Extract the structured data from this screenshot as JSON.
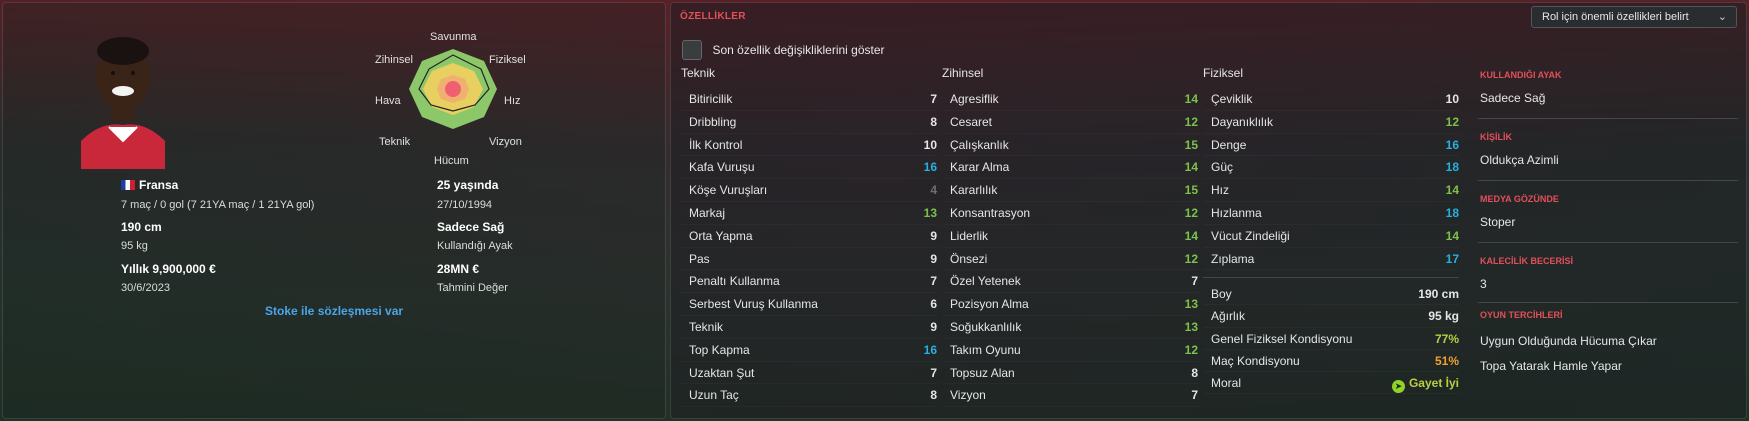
{
  "player": {
    "nationality": "Fransa",
    "caps": "7 maç / 0 gol (7 21YA maç / 1 21YA gol)",
    "age": "25 yaşında",
    "dob": "27/10/1994",
    "height": "190 cm",
    "weight": "95 kg",
    "foot": "Sadece Sağ",
    "foot_label": "Kullandığı Ayak",
    "wage": "Yıllık 9,900,000 €",
    "contract_end": "30/6/2023",
    "value": "28MN €",
    "value_label": "Tahmini Değer",
    "contract_text": "Stoke ile sözleşmesi var"
  },
  "radar": {
    "labels": {
      "top": "Savunma",
      "top_right": "Fiziksel",
      "right": "Hız",
      "bottom_right": "Vizyon",
      "bottom": "Hücum",
      "bottom_left": "Teknik",
      "left": "Hava",
      "top_left": "Zihinsel"
    },
    "colors": {
      "outer": "#8cc86a",
      "mid": "#e8d060",
      "inner": "#f0b070",
      "core": "#f06070"
    }
  },
  "attributes": {
    "section_title": "ÖZELLİKLER",
    "role_select": "Rol için önemli özellikleri belirt",
    "show_changes": "Son özellik değişikliklerini göster",
    "technical": {
      "title": "Teknik",
      "rows": [
        {
          "name": "Bitiricilik",
          "value": "7",
          "c": "white"
        },
        {
          "name": "Dribbling",
          "value": "8",
          "c": "white"
        },
        {
          "name": "İlk Kontrol",
          "value": "10",
          "c": "white"
        },
        {
          "name": "Kafa Vuruşu",
          "value": "16",
          "c": "blue"
        },
        {
          "name": "Köşe Vuruşları",
          "value": "4",
          "c": "gray"
        },
        {
          "name": "Markaj",
          "value": "13",
          "c": "green"
        },
        {
          "name": "Orta Yapma",
          "value": "9",
          "c": "white"
        },
        {
          "name": "Pas",
          "value": "9",
          "c": "white"
        },
        {
          "name": "Penaltı Kullanma",
          "value": "7",
          "c": "white"
        },
        {
          "name": "Serbest Vuruş Kullanma",
          "value": "6",
          "c": "white"
        },
        {
          "name": "Teknik",
          "value": "9",
          "c": "white"
        },
        {
          "name": "Top Kapma",
          "value": "16",
          "c": "blue"
        },
        {
          "name": "Uzaktan Şut",
          "value": "7",
          "c": "white"
        },
        {
          "name": "Uzun Taç",
          "value": "8",
          "c": "white"
        }
      ]
    },
    "mental": {
      "title": "Zihinsel",
      "rows": [
        {
          "name": "Agresiflik",
          "value": "14",
          "c": "green"
        },
        {
          "name": "Cesaret",
          "value": "12",
          "c": "green"
        },
        {
          "name": "Çalışkanlık",
          "value": "15",
          "c": "green"
        },
        {
          "name": "Karar Alma",
          "value": "14",
          "c": "green"
        },
        {
          "name": "Kararlılık",
          "value": "15",
          "c": "green"
        },
        {
          "name": "Konsantrasyon",
          "value": "12",
          "c": "green"
        },
        {
          "name": "Liderlik",
          "value": "14",
          "c": "green"
        },
        {
          "name": "Önsezi",
          "value": "12",
          "c": "green"
        },
        {
          "name": "Özel Yetenek",
          "value": "7",
          "c": "white"
        },
        {
          "name": "Pozisyon Alma",
          "value": "13",
          "c": "green"
        },
        {
          "name": "Soğukkanlılık",
          "value": "13",
          "c": "green"
        },
        {
          "name": "Takım Oyunu",
          "value": "12",
          "c": "green"
        },
        {
          "name": "Topsuz Alan",
          "value": "8",
          "c": "white"
        },
        {
          "name": "Vizyon",
          "value": "7",
          "c": "white"
        }
      ]
    },
    "physical": {
      "title": "Fiziksel",
      "rows": [
        {
          "name": "Çeviklik",
          "value": "10",
          "c": "white"
        },
        {
          "name": "Dayanıklılık",
          "value": "12",
          "c": "green"
        },
        {
          "name": "Denge",
          "value": "16",
          "c": "blue"
        },
        {
          "name": "Güç",
          "value": "18",
          "c": "blue"
        },
        {
          "name": "Hız",
          "value": "14",
          "c": "green"
        },
        {
          "name": "Hızlanma",
          "value": "18",
          "c": "blue"
        },
        {
          "name": "Vücut Zindeliği",
          "value": "14",
          "c": "green"
        },
        {
          "name": "Zıplama",
          "value": "17",
          "c": "blue"
        }
      ],
      "extra": [
        {
          "name": "Boy",
          "value": "190 cm",
          "c": "white"
        },
        {
          "name": "Ağırlık",
          "value": "95 kg",
          "c": "white"
        },
        {
          "name": "Genel Fiziksel Kondisyonu",
          "value": "77%",
          "c": "yellow"
        },
        {
          "name": "Maç Kondisyonu",
          "value": "51%",
          "c": "orange"
        },
        {
          "name": "Moral",
          "value": "Gayet İyi",
          "c": "yellow"
        }
      ]
    }
  },
  "side": {
    "preferred_foot_title": "KULLANDIĞI AYAK",
    "preferred_foot": "Sadece Sağ",
    "personality_title": "KİŞİLİK",
    "personality": "Oldukça Azimli",
    "media_title": "MEDYA GÖZÜNDE",
    "media": "Stoper",
    "gk_title": "KALECİLİK BECERİSİ",
    "gk": "3",
    "prefs_title": "OYUN TERCİHLERİ",
    "prefs": [
      "Uygun Olduğunda Hücuma Çıkar",
      "Topa Yatarak Hamle Yapar"
    ]
  }
}
